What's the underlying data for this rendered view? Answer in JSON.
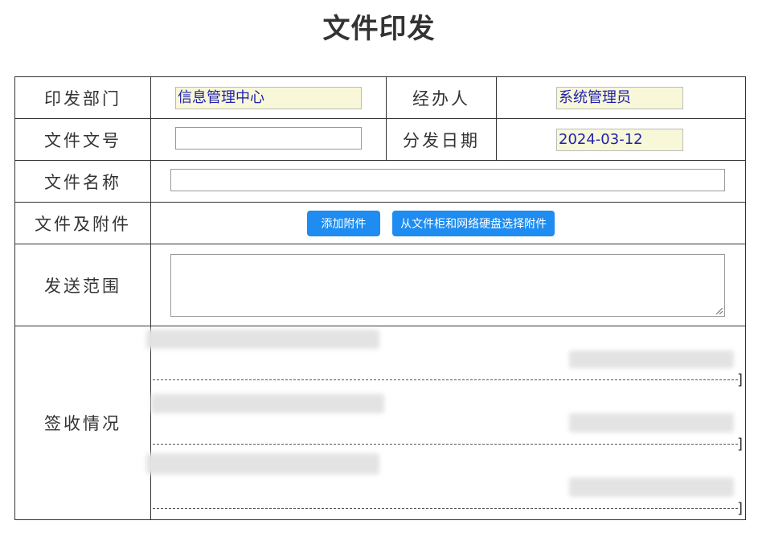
{
  "page": {
    "title": "文件印发"
  },
  "form": {
    "dept_label": "印发部门",
    "dept_value": "信息管理中心",
    "handler_label": "经办人",
    "handler_value": "系统管理员",
    "doc_no_label": "文件文号",
    "doc_no_value": "",
    "date_label": "分发日期",
    "date_value": "2024-03-12",
    "name_label": "文件名称",
    "name_value": "",
    "attach_label": "文件及附件",
    "add_attach_button": "添加附件",
    "cabinet_button": "从文件柜和网络硬盘选择附件",
    "scope_label": "发送范围",
    "scope_value": "",
    "receipt_label": "签收情况"
  },
  "receipt": {
    "entries": [
      {
        "bracket": "]"
      },
      {
        "bracket": "]"
      },
      {
        "bracket": "]"
      }
    ]
  }
}
